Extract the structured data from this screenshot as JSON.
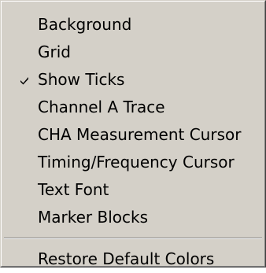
{
  "menu": {
    "items": [
      {
        "label": "Background",
        "checked": false
      },
      {
        "label": "Grid",
        "checked": false
      },
      {
        "label": "Show Ticks",
        "checked": true
      },
      {
        "label": "Channel A Trace",
        "checked": false
      },
      {
        "label": "CHA Measurement Cursor",
        "checked": false
      },
      {
        "label": "Timing/Frequency Cursor",
        "checked": false
      },
      {
        "label": "Text Font",
        "checked": false
      },
      {
        "label": "Marker Blocks",
        "checked": false
      }
    ],
    "footer_item": {
      "label": "Restore Default Colors"
    },
    "check_icon": "checkmark-icon",
    "colors": {
      "background": "#d4d0c8",
      "text": "#000000",
      "highlight": "#ffffff",
      "shadow": "#808080"
    }
  }
}
